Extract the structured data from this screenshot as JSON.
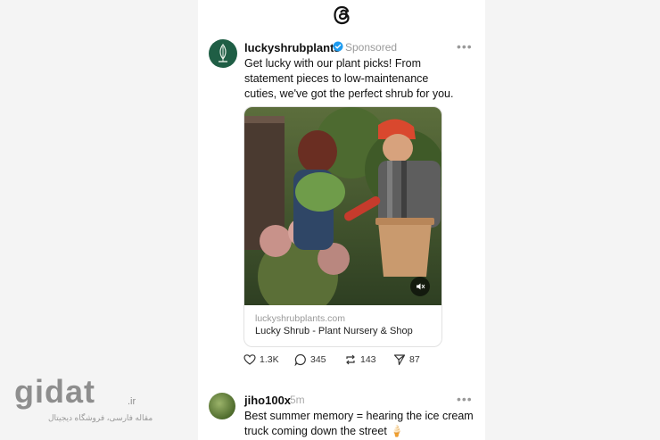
{
  "post1": {
    "username": "luckyshrubplants",
    "badge": "Sponsored",
    "more": "•••",
    "lines": [
      "Get lucky with our plant picks! From",
      "statement pieces to low-maintenance",
      "cuties, we've got the perfect shrub for you."
    ],
    "link_domain": "luckyshrubplants.com",
    "link_title": "Lucky Shrub - Plant Nursery & Shop",
    "likes": "1.3K",
    "replies": "345",
    "reposts": "143",
    "shares": "87"
  },
  "post2": {
    "username": "jiho100x",
    "time": "5m",
    "more": "•••",
    "lines": [
      "Best summer memory = hearing the ice cream",
      "truck coming down the street 🍦"
    ]
  },
  "watermark": {
    "brand": "gidat",
    "tld": ".ir",
    "tagline": "مقاله فارسی، فروشگاه دیجیتال"
  }
}
